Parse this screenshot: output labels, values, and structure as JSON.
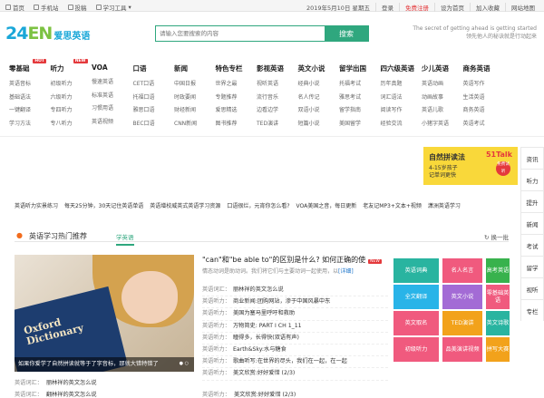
{
  "topbar": {
    "left": [
      "首页",
      "手机站",
      "投稿",
      "学习工具"
    ],
    "date": "2019年5月10日 星期五",
    "login": "登录",
    "register": "免费注册",
    "right": [
      "设为首页",
      "加入收藏",
      "网站地图"
    ]
  },
  "logo": {
    "digits": "24",
    "letters": "EN",
    "cn": "爱思英语"
  },
  "search": {
    "placeholder": "请输入您要搜索的内容",
    "button": "搜索"
  },
  "slogan": {
    "line1": "The secret of getting ahead is getting started",
    "line2": "领先他人的秘诀就是行动起来"
  },
  "nav": [
    {
      "title": "零基础",
      "badge": "HOT",
      "items": [
        "英语音标",
        "基础语法",
        "一键翻译",
        "学习方法"
      ]
    },
    {
      "title": "听力",
      "badge": "NEW",
      "items": [
        "初级听力",
        "六级听力",
        "专四听力",
        "专八听力"
      ]
    },
    {
      "title": "VOA",
      "badge": "",
      "items": [
        "慢速英语",
        "标准英语",
        "习惯用语",
        "英语视频"
      ]
    },
    {
      "title": "口语",
      "badge": "",
      "items": [
        "CET口语",
        "托福口语",
        "雅思口语",
        "BEC口语"
      ]
    },
    {
      "title": "新闻",
      "badge": "",
      "items": [
        "中国日报",
        "时政要闻",
        "财经新闻",
        "CNN新闻"
      ]
    },
    {
      "title": "特色专栏",
      "badge": "",
      "items": [
        "世界之最",
        "专题推荐",
        "爱思精选",
        "图书推荐"
      ]
    },
    {
      "title": "影视英语",
      "badge": "",
      "items": [
        "视听英语",
        "流行音乐",
        "边看边学",
        "TED演讲"
      ]
    },
    {
      "title": "英文小说",
      "badge": "",
      "items": [
        "经典小说",
        "名人传记",
        "双语小说",
        "短篇小说"
      ]
    },
    {
      "title": "留学出国",
      "badge": "",
      "items": [
        "托福考试",
        "雅思考试",
        "留学指南",
        "美国留学"
      ]
    },
    {
      "title": "四六级英语",
      "badge": "",
      "items": [
        "历年真题",
        "词汇语法",
        "阅读写作",
        "经验交流"
      ]
    },
    {
      "title": "少儿英语",
      "badge": "",
      "items": [
        "英语动画",
        "动画故事",
        "英语儿歌",
        "小猪字英语"
      ]
    },
    {
      "title": "商务英语",
      "badge": "",
      "items": [
        "英语写作",
        "生活英语",
        "商务英语",
        "英语考试"
      ]
    }
  ],
  "banner": {
    "title": "自然拼读法",
    "line1": "4-15岁孩子",
    "line2": "记单词更快",
    "brand": "51Talk",
    "badge": "免费试听"
  },
  "side": [
    "资讯",
    "听力",
    "提升",
    "新闻",
    "考试",
    "留学",
    "视听",
    "专栏"
  ],
  "links": [
    "英语听力实景练习",
    "每天25分钟，30天记住英语单语",
    "英语增校威英式英语学习资源",
    "口语很烂，元宵你怎么看?",
    "VOA美国之音，每日更新",
    "老友记MP3+文本+视频",
    "潇洲英语学习"
  ],
  "section": {
    "title": "英语学习热门推荐",
    "tab": "学英语",
    "change": "换一批"
  },
  "photo": {
    "caption": "如果你爱学了自然拼读就等于了字音标，那就大错特错了",
    "book": "Oxford Dictionary"
  },
  "headline": {
    "text": "\"can\"和\"be able to\"的区别是什么? 如何正确的使",
    "badge": "NEW"
  },
  "summary": {
    "text": "情态动词是助动词。我们将它们与主要动词一起使用，以",
    "more": "[详细]"
  },
  "list": [
    {
      "cat": "英语词汇：",
      "title": "丽林祥的英文怎么说"
    },
    {
      "cat": "英语听力：",
      "title": "商业新闻:团购网站，渗于中国风暴中东"
    },
    {
      "cat": "英语听力：",
      "title": "美国为塞马里呼吁和救助"
    },
    {
      "cat": "英语听力：",
      "title": "万物简史: PART I CH 1_11"
    },
    {
      "cat": "英语听力：",
      "title": "瞳得多，长得快(双语有声)"
    },
    {
      "cat": "英语听力：",
      "title": "Earth&Sky:水与糖食"
    },
    {
      "cat": "英语听力：",
      "title": "歌曲听写:在世界的尽头，我们在一起，在一起"
    },
    {
      "cat": "英语听力：",
      "title": "美文欣赏:好好爱惜 (2/3)"
    }
  ],
  "tiles": [
    {
      "label": "英语词典",
      "color": "#29b4a0"
    },
    {
      "label": "名人名言",
      "color": "#f05a7e"
    },
    {
      "label": "高考英语",
      "color": "#38b24d"
    },
    {
      "label": "全文翻译",
      "color": "#29b4e8"
    },
    {
      "label": "英文小说",
      "color": "#a36bd5"
    },
    {
      "label": "零基础英语",
      "color": "#f05a7e"
    },
    {
      "label": "英文取名",
      "color": "#f05a7e"
    },
    {
      "label": "TED演讲",
      "color": "#f2a21b"
    },
    {
      "label": "英文诗歌",
      "color": "#29b4a0"
    },
    {
      "label": "英语写作",
      "color": "#29b4e8"
    },
    {
      "label": "握行我读",
      "color": "#a36bd5"
    },
    {
      "label": "英语名言",
      "color": "#38b24d"
    },
    {
      "label": "初级听力",
      "color": "#f05a7e"
    },
    {
      "label": "品美演讲视频",
      "color": "#f05a7e"
    },
    {
      "label": "英语四级",
      "color": "#29b4e8"
    },
    {
      "label": "拼写大赛",
      "color": "#f2a21b"
    }
  ],
  "below": [
    {
      "cat": "英语词汇：",
      "title": "丽林祥的英文怎么说"
    },
    {
      "cat": "英语词汇：",
      "title": "翻林祥的英文怎么说"
    },
    {
      "cat": "英语听力：",
      "title": "美文欣赏:好好爱惜 (2/3)"
    }
  ]
}
